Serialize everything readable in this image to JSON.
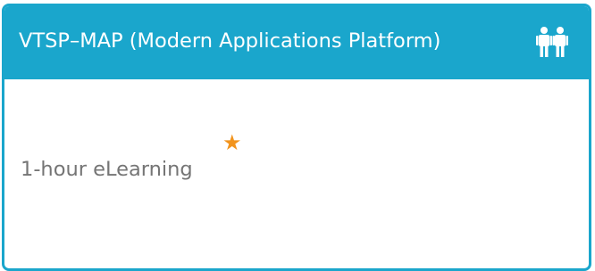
{
  "card": {
    "title": "VTSP–MAP (Modern Applications Platform)",
    "header_icon": "people-icon",
    "rating_icon": "star-icon",
    "star_glyph": "★",
    "course_format": "1-hour eLearning"
  },
  "colors": {
    "header_background": "#1aa6cc",
    "header_text": "#ffffff",
    "star": "#f2941d",
    "body_text": "#757575"
  }
}
